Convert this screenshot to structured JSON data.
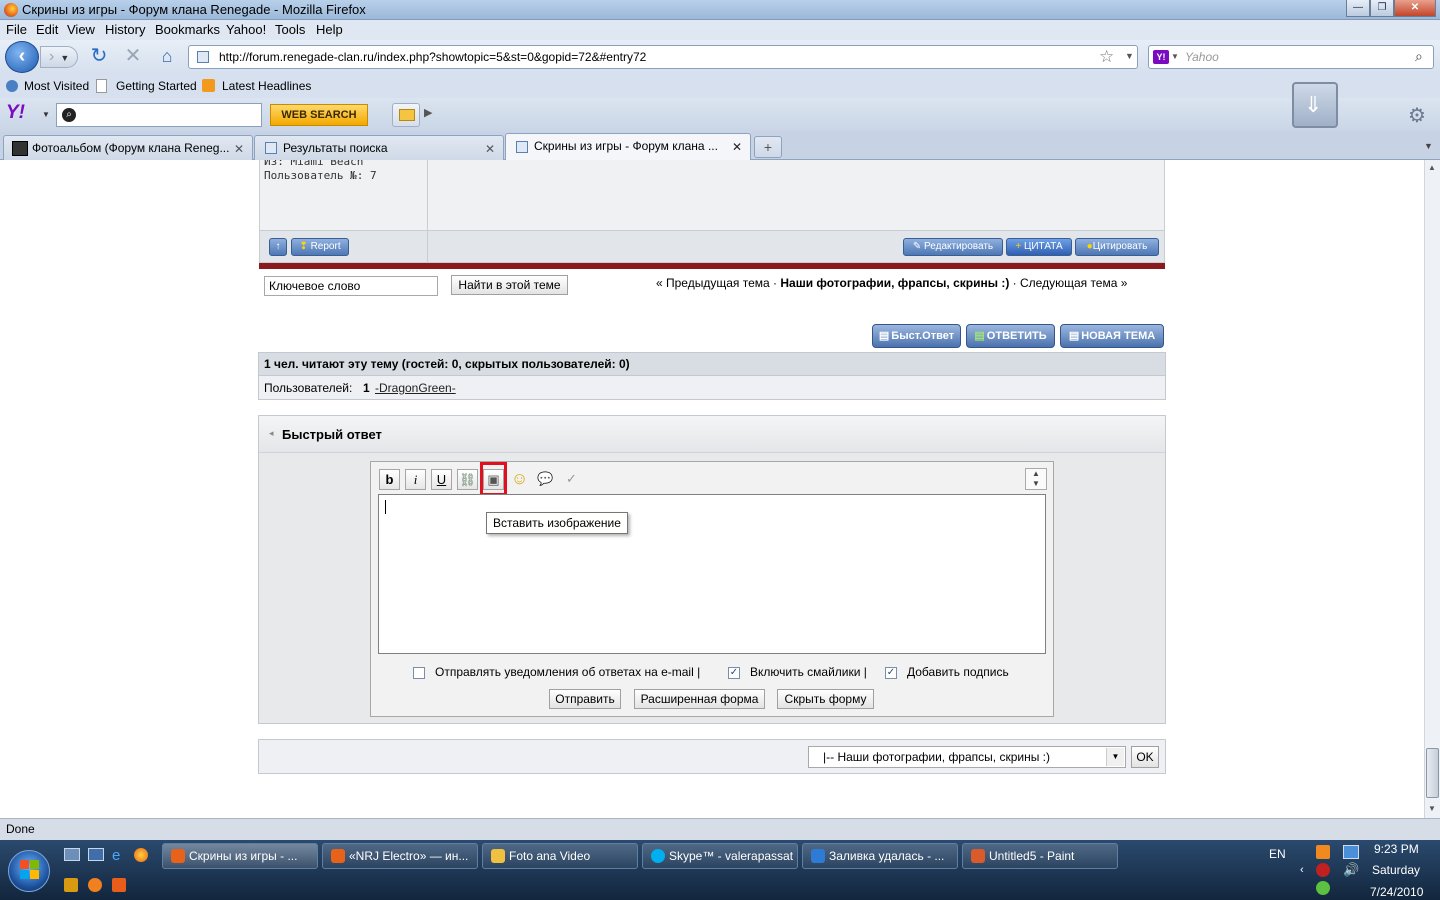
{
  "window": {
    "title": "Скрины из игры - Форум клана Renegade - Mozilla Firefox",
    "min": "—",
    "max": "❐",
    "close": "✕"
  },
  "menu": [
    "File",
    "Edit",
    "View",
    "History",
    "Bookmarks",
    "Yahoo!",
    "Tools",
    "Help"
  ],
  "nav": {
    "url": "http://forum.renegade-clan.ru/index.php?showtopic=5&st=0&gopid=72&#entry72",
    "search_placeholder": "Yahoo"
  },
  "bookmarks": [
    "Most Visited",
    "Getting Started",
    "Latest Headlines"
  ],
  "yahoo": {
    "logo": "Y!",
    "web_search": "WEB SEARCH"
  },
  "tabs": [
    {
      "label": "Фотоальбом (Форум клана Reneg..."
    },
    {
      "label": "Результаты поиска"
    },
    {
      "label": "Скрины из игры - Форум клана ..."
    }
  ],
  "post": {
    "from": "Из: Miami Beach",
    "user_no": "Пользователь №: 7",
    "report": "Report",
    "edit": "Редактировать",
    "quote_plus": "ЦИТАТА",
    "quote": "Цитировать"
  },
  "topic_search": {
    "value": "Ключевое слово",
    "button": "Найти в этой теме"
  },
  "topic_nav": {
    "prev": "« Предыдущая тема",
    "sep1": " · ",
    "current": "Наши фотографии, фрапсы, скрины :)",
    "sep2": " · ",
    "next": "Следующая тема »"
  },
  "action_buttons": {
    "fast_reply": "Быст.Ответ",
    "reply": "ОТВЕТИТЬ",
    "new_topic": "НОВАЯ ТЕМА"
  },
  "readers": {
    "header": "1 чел. читают эту тему (гостей: 0, скрытых пользователей: 0)",
    "users_label": "Пользователей:",
    "count": "1",
    "user": "-DragonGreen-"
  },
  "quick_reply": {
    "title": "Быстрый ответ",
    "toolbar": {
      "bold": "b",
      "italic": "i",
      "underline": "U"
    },
    "tooltip": "Вставить изображение",
    "opt_email": "Отправлять уведомления об ответах на e-mail |",
    "opt_smilies": "Включить смайлики |",
    "opt_signature": "Добавить подпись",
    "send": "Отправить",
    "advanced": "Расширенная форма",
    "hide": "Скрыть форму"
  },
  "jump": {
    "selected": "|-- Наши фотографии, фрапсы, скрины :)",
    "ok": "OK"
  },
  "status": "Done",
  "taskbar": {
    "items": [
      {
        "label": "Скрины из игры - ...",
        "color": "#e8621a"
      },
      {
        "label": "«NRJ Electro» — ин...",
        "color": "#e8621a"
      },
      {
        "label": "Foto ana Video",
        "color": "#f0c040"
      },
      {
        "label": "Skype™ - valerapassat",
        "color": "#00aff0"
      },
      {
        "label": "Заливка удалась - ...",
        "color": "#2e7bd6"
      },
      {
        "label": "Untitled5 - Paint",
        "color": "#d95a2a"
      }
    ],
    "lang": "EN",
    "time": "9:23 PM",
    "day": "Saturday",
    "date": "7/24/2010"
  }
}
